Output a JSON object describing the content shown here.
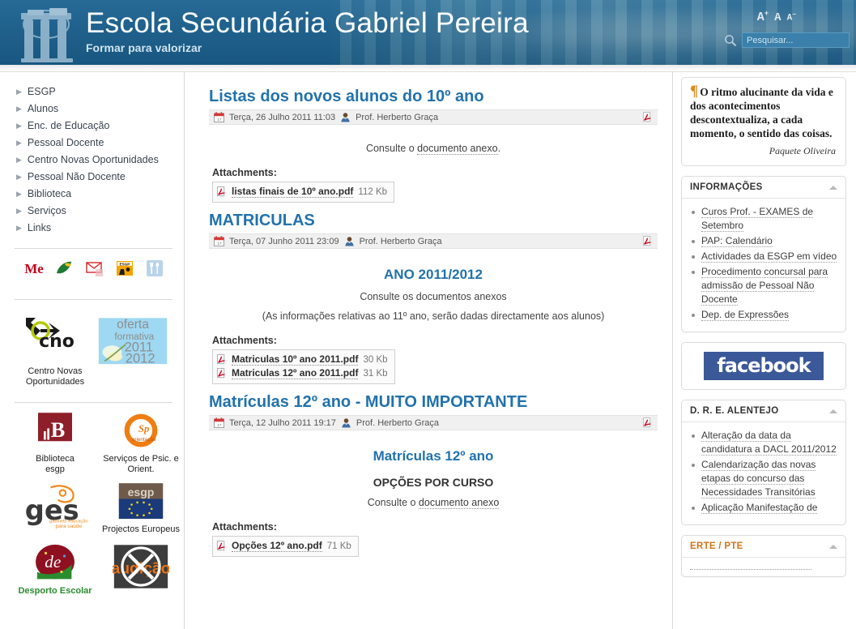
{
  "header": {
    "title": "Escola Secundária Gabriel Pereira",
    "tagline": "Formar para valorizar",
    "font_big": "A",
    "font_mid": "A",
    "font_small": "A",
    "font_big_sup": "+",
    "font_small_sup": "−",
    "search_placeholder": "Pesquisar...",
    "brand_color": "#1b6291",
    "link_color": "#2272ac"
  },
  "sidebar_left": {
    "nav": [
      {
        "label": "ESGP"
      },
      {
        "label": "Alunos"
      },
      {
        "label": "Enc. de Educação"
      },
      {
        "label": "Pessoal Docente"
      },
      {
        "label": "Centro Novas Oportunidades"
      },
      {
        "label": "Pessoal Não Docente"
      },
      {
        "label": "Biblioteca"
      },
      {
        "label": "Serviços"
      },
      {
        "label": "Links"
      }
    ],
    "social_icons": [
      {
        "name": "ministerio-educacao-icon"
      },
      {
        "name": "leaf-logo-icon"
      },
      {
        "name": "webmail-envelope-icon"
      },
      {
        "name": "esgp-moodle-icon"
      },
      {
        "name": "cantina-cutlery-icon"
      }
    ],
    "promos": [
      {
        "name": "cno-logo",
        "caption": "Centro Novas Oportunidades",
        "logo_text": "cno"
      },
      {
        "name": "oferta-formativa-banner",
        "caption": "",
        "logo_lines": [
          "oferta",
          "formativa",
          "2011",
          "2012"
        ]
      }
    ],
    "logos": [
      {
        "name": "biblioteca-esgp-logo",
        "caption": "",
        "badge_main": "B",
        "badge_sub": "Biblioteca",
        "badge_sub2": "esgp"
      },
      {
        "name": "spo-logo",
        "caption": "Serviços de Psic. e Orient.",
        "badge_main": "Sp"
      },
      {
        "name": "ges-logo",
        "caption": "",
        "badge_main": "ges",
        "badge_sub": "gabinete educação para saúde"
      },
      {
        "name": "projectos-europeus-logo",
        "caption": "Projectos Europeus",
        "badge_main": "esgp"
      },
      {
        "name": "desporto-escolar-logo",
        "caption": "Desporto Escolar",
        "badge_main": "de"
      },
      {
        "name": "audicao-logo",
        "caption": "",
        "badge_main": "audição"
      }
    ]
  },
  "articles": [
    {
      "title": "Listas dos novos alunos do 10º ano",
      "date": "Terça, 26 Julho 2011 11:03",
      "author": "Prof. Herberto Graça",
      "body": [
        {
          "type": "para-center",
          "text": "Consulte o ",
          "link": "documento anexo",
          "tail": "."
        }
      ],
      "attachments_label": "Attachments:",
      "attachments": [
        {
          "name": "listas finais de 10º ano.pdf",
          "size": "112 Kb"
        }
      ]
    },
    {
      "title": "MATRICULAS",
      "date": "Terça, 07 Junho 2011 23:09",
      "author": "Prof. Herberto Graça",
      "heading_blue": "ANO 2011/2012",
      "body": [
        {
          "type": "para-center",
          "text": "Consulte os documentos anexos"
        },
        {
          "type": "para-center",
          "text": "(As informações relativas ao 11º ano, serão dadas directamente aos alunos)"
        }
      ],
      "attachments_label": "Attachments:",
      "attachments": [
        {
          "name": "Matriculas 10º ano 2011.pdf",
          "size": "30 Kb"
        },
        {
          "name": "Matriculas 12º ano 2011.pdf",
          "size": "31 Kb"
        }
      ]
    },
    {
      "title": "Matrículas 12º ano - MUITO IMPORTANTE",
      "date": "Terça, 12 Julho 2011 19:17",
      "author": "Prof. Herberto Graça",
      "heading_blue": "Matrículas 12º ano",
      "heading_bold": "OPÇÕES POR CURSO",
      "body": [
        {
          "type": "para-center",
          "text": "Consulte o ",
          "link": "documento anexo",
          "tail": ""
        }
      ],
      "attachments_label": "Attachments:",
      "attachments": [
        {
          "name": "Opções 12º ano.pdf",
          "size": "71 Kb"
        }
      ]
    }
  ],
  "sidebar_right": {
    "quote": {
      "text": "O ritmo alucinante da vida e dos acontecimentos descontextualiza, a cada momento, o sentido das coisas.",
      "author": "Paquete Oliveira"
    },
    "modules": [
      {
        "title": "INFORMAÇÕES",
        "title_color": "#333333",
        "items": [
          "Curos Prof. - EXAMES de Setembro",
          "PAP: Calendário",
          "Actividades da ESGP em vídeo",
          "Procedimento concursal para admissão de Pessoal Não Docente",
          "Dep. de Expressões"
        ]
      },
      {
        "title": "D. R. E. ALENTEJO",
        "title_color": "#333333",
        "items": [
          "Alteração da data da candidatura a DACL 2011/2012",
          "Calendarização das novas etapas do concurso das Necessidades Transitórias",
          "Aplicação Manifestação de"
        ]
      },
      {
        "title": "ERTE / PTE",
        "title_color": "#cf7417",
        "items": []
      }
    ],
    "facebook": {
      "label": "facebook",
      "color": "#3b5998"
    }
  }
}
